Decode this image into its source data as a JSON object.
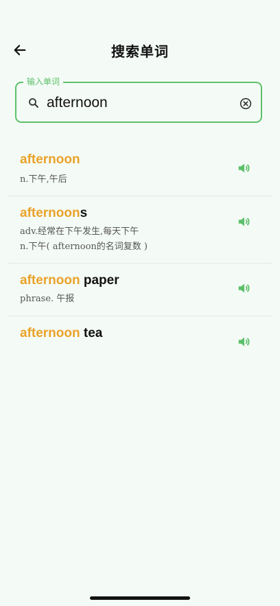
{
  "header": {
    "title": "搜索单词"
  },
  "search": {
    "legend": "输入单词",
    "value": "afternoon"
  },
  "results": [
    {
      "match": "afternoon",
      "rest": "",
      "definitions": [
        "n.下午,午后"
      ]
    },
    {
      "match": "afternoon",
      "rest": "s",
      "definitions": [
        "adv.经常在下午发生,每天下午",
        "n.下午( afternoon的名词复数 )"
      ]
    },
    {
      "match": "afternoon",
      "rest": " paper",
      "definitions": [
        "phrase. 午报"
      ]
    },
    {
      "match": "afternoon",
      "rest": " tea",
      "definitions": []
    }
  ],
  "colors": {
    "accent_green": "#5cc06a",
    "highlight_orange": "#eaa22a",
    "background": "#f4fbf6"
  },
  "icons": {
    "back": "arrow-left-icon",
    "search": "search-icon",
    "clear": "clear-circle-icon",
    "speaker": "speaker-icon"
  }
}
